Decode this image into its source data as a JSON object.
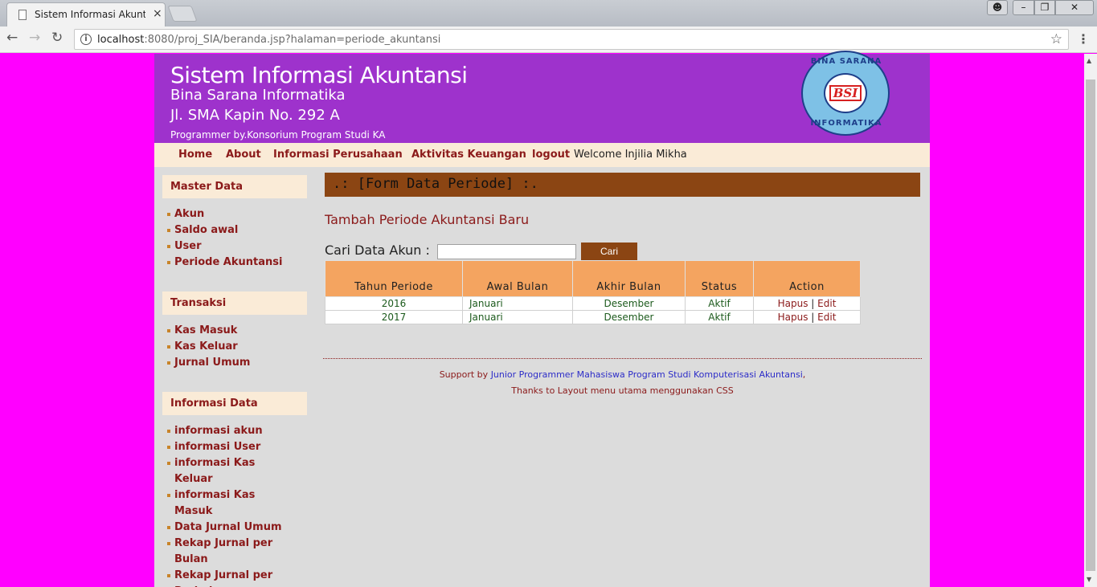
{
  "browser": {
    "tab_title": "Sistem Informasi Akuntansi",
    "tab_close": "×",
    "url_host": "localhost",
    "url_path": ":8080/proj_SIA/beranda.jsp?halaman=periode_akuntansi",
    "win_min": "–",
    "win_max": "❐",
    "win_close": "✕"
  },
  "header": {
    "title": "Sistem Informasi Akuntansi",
    "subtitle": "Bina Sarana Informatika",
    "address": "Jl. SMA Kapin No. 292 A",
    "programmer": "Programmer by.Konsorium Program Studi KA",
    "logo_top": "BINA SARANA",
    "logo_mark": "BSI",
    "logo_bottom": "INFORMATIKA"
  },
  "nav": {
    "home": "Home",
    "about": "About",
    "info_perusahaan": "Informasi Perusahaan",
    "aktivitas": "Aktivitas Keuangan",
    "logout": "logout",
    "welcome": "Welcome Injilia Mikha"
  },
  "sidebar": {
    "master": {
      "title": "Master Data",
      "items": [
        "Akun",
        "Saldo awal",
        "User",
        "Periode Akuntansi"
      ]
    },
    "transaksi": {
      "title": "Transaksi",
      "items": [
        "Kas Masuk",
        "Kas Keluar",
        "Jurnal Umum"
      ]
    },
    "informasi": {
      "title": "Informasi Data",
      "items": [
        "informasi akun",
        "informasi User",
        "informasi Kas Keluar",
        "informasi Kas Masuk",
        "Data Jurnal Umum",
        "Rekap Jurnal per Bulan",
        "Rekap Jurnal per Periode"
      ]
    }
  },
  "main": {
    "form_title": ".: [Form Data Periode] :.",
    "add_link": "Tambah Periode Akuntansi Baru",
    "search_label": "Cari Data Akun :",
    "search_value": "",
    "search_button": "Cari",
    "table": {
      "headers": [
        "Tahun Periode",
        "Awal Bulan",
        "Akhir Bulan",
        "Status",
        "Action"
      ],
      "rows": [
        {
          "tahun": "2016",
          "awal": "Januari",
          "akhir": "Desember",
          "status": "Aktif",
          "hapus": "Hapus",
          "sep": "|",
          "edit": "Edit"
        },
        {
          "tahun": "2017",
          "awal": "Januari",
          "akhir": "Desember",
          "status": "Aktif",
          "hapus": "Hapus",
          "sep": "|",
          "edit": "Edit"
        }
      ]
    }
  },
  "footer": {
    "support_prefix": "Support by",
    "support_link": "Junior Programmer Mahasiswa Program Studi Komputerisasi Akuntansi",
    "support_suffix": ",",
    "thanks": "Thanks to Layout menu utama menggunakan CSS"
  }
}
